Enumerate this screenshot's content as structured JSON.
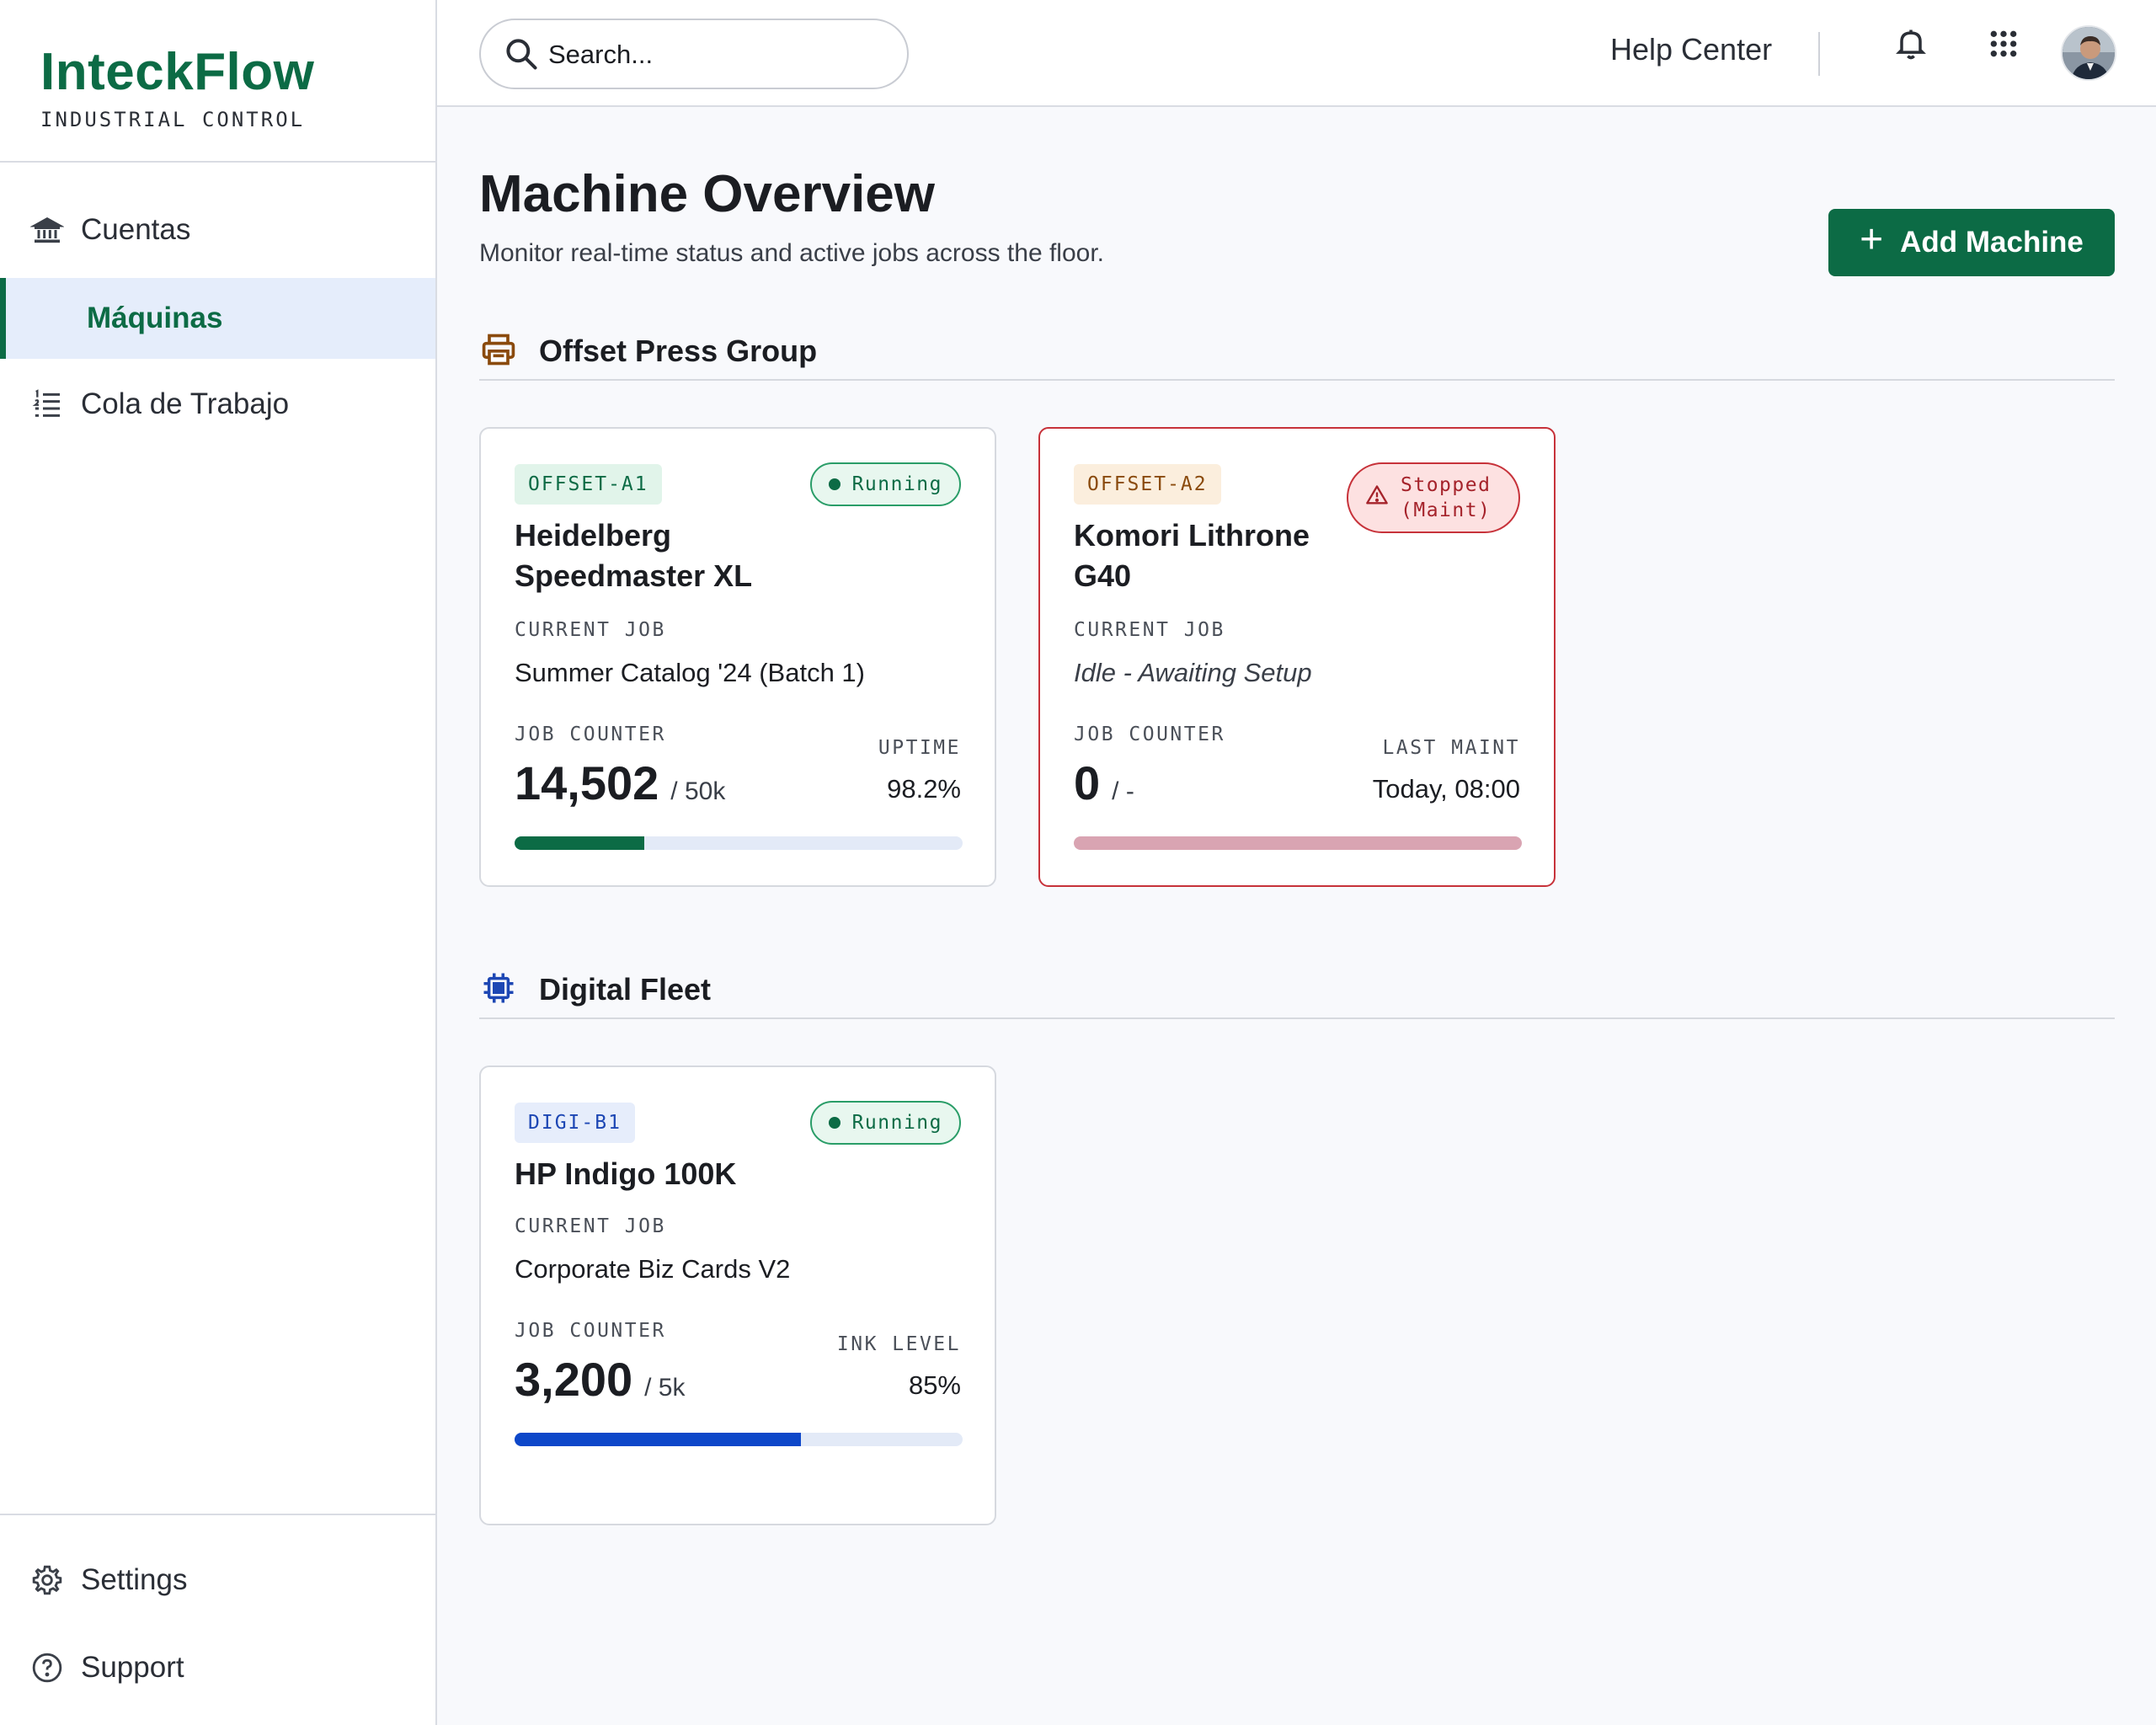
{
  "brand": {
    "name": "InteckFlow",
    "subtitle": "INDUSTRIAL CONTROL"
  },
  "sidebar": {
    "items": [
      {
        "label": "Cuentas",
        "icon": "bank-icon"
      },
      {
        "label": "Máquinas",
        "icon": "",
        "active": true
      },
      {
        "label": "Cola de Trabajo",
        "icon": "list-icon"
      }
    ],
    "bottom": [
      {
        "label": "Settings",
        "icon": "gear-icon"
      },
      {
        "label": "Support",
        "icon": "help-circle-icon"
      }
    ]
  },
  "topbar": {
    "search_placeholder": "Search...",
    "help_label": "Help Center",
    "icons": [
      "search-icon",
      "bell-icon",
      "apps-grid-icon",
      "avatar"
    ]
  },
  "page": {
    "title": "Machine Overview",
    "subtitle": "Monitor real-time status and active jobs across the floor.",
    "add_button": "Add Machine"
  },
  "sections": [
    {
      "title": "Offset Press Group",
      "icon": "printer-icon",
      "icon_color": "#8a4a0c",
      "machines": [
        {
          "tag": "OFFSET-A1",
          "status": "Running",
          "name": "Heidelberg Speedmaster XL",
          "job_label": "CURRENT JOB",
          "job": "Summer Catalog '24 (Batch 1)",
          "counter_label": "JOB COUNTER",
          "counter": "14,502",
          "counter_total": "/ 50k",
          "metric_label": "UPTIME",
          "metric_value": "98.2%",
          "progress": 0.29,
          "bar_color": "#0c6b45"
        },
        {
          "tag": "OFFSET-A2",
          "status": "Stopped (Maint)",
          "name": "Komori Lithrone G40",
          "job_label": "CURRENT JOB",
          "job": "Idle - Awaiting Setup",
          "counter_label": "JOB COUNTER",
          "counter": "0",
          "counter_total": "/ -",
          "metric_label": "LAST MAINT",
          "metric_value": "Today, 08:00",
          "progress": 1.0,
          "bar_color": "#d9a4b2"
        }
      ]
    },
    {
      "title": "Digital Fleet",
      "icon": "chip-icon",
      "icon_color": "#1d47b4",
      "machines": [
        {
          "tag": "DIGI-B1",
          "status": "Running",
          "name": "HP Indigo 100K",
          "job_label": "CURRENT JOB",
          "job": "Corporate Biz Cards V2",
          "counter_label": "JOB COUNTER",
          "counter": "3,200",
          "counter_total": "/ 5k",
          "metric_label": "INK LEVEL",
          "metric_value": "85%",
          "progress": 0.64,
          "bar_color": "#0d47c9"
        }
      ]
    }
  ]
}
